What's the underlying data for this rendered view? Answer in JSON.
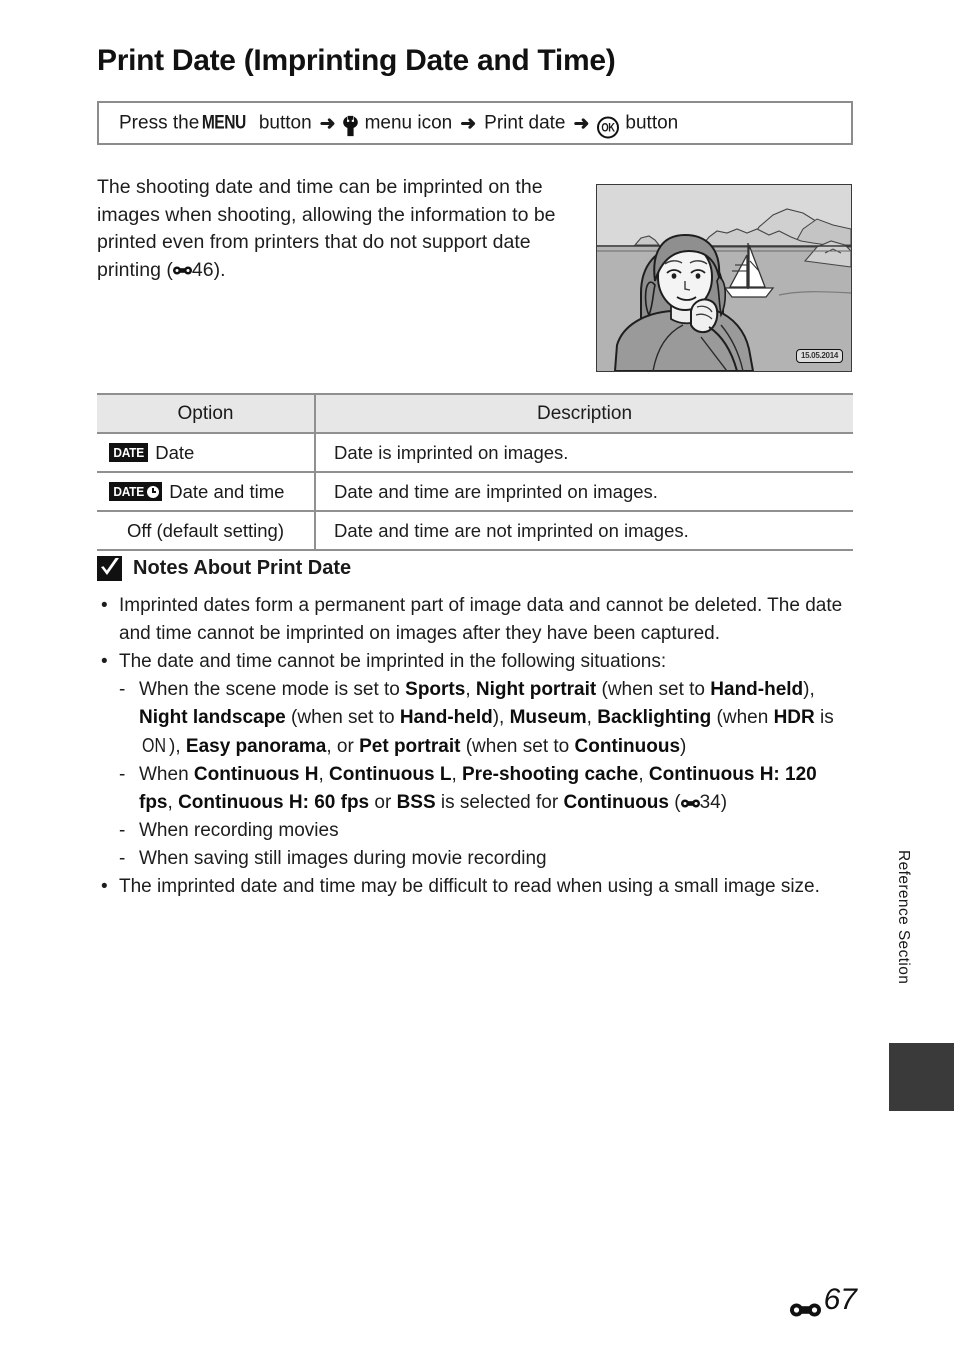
{
  "page": {
    "title": "Print Date (Imprinting Date and Time)",
    "number": "67",
    "number_symbol": "E-reference-icon",
    "section_tab": "Reference Section"
  },
  "menu_path": {
    "press_the": "Press the",
    "menu_glyph": "MENU",
    "button_1": "button",
    "arrow": "➜",
    "setup_icon": "wrench-icon",
    "menu_icon_label": "menu icon",
    "item": "Print date",
    "ok_glyph": "OK",
    "button_2": "button"
  },
  "intro": {
    "part1": "The shooting date and time can be imprinted on the images when shooting, allowing the information to be printed even from printers that do not support date printing (",
    "ref_page": "46",
    "part2": ")."
  },
  "illustration": {
    "alt": "camera-sample-photo",
    "date_stamp": "15.05.2014"
  },
  "table": {
    "headers": [
      "Option",
      "Description"
    ],
    "rows": [
      {
        "badge": "DATE",
        "badge_clock": false,
        "option": "Date",
        "description": "Date is imprinted on images."
      },
      {
        "badge": "DATE",
        "badge_clock": true,
        "option": "Date and time",
        "description": "Date and time are imprinted on images."
      },
      {
        "badge": null,
        "badge_clock": false,
        "option": "Off (default setting)",
        "description": "Date and time are not imprinted on images."
      }
    ]
  },
  "notes": {
    "icon": "check-mark-icon",
    "heading": "Notes About Print Date",
    "bullet_char": "•",
    "dash_char": "-",
    "items": [
      "Imprinted dates form a permanent part of image data and cannot be deleted. The date and time cannot be imprinted on images after they have been captured.",
      "The date and time cannot be imprinted in the following situations:"
    ],
    "sub_items": [
      {
        "id": "scene-modes",
        "segments": [
          {
            "t": "When the scene mode is set to ",
            "b": false
          },
          {
            "t": "Sports",
            "b": true
          },
          {
            "t": ", ",
            "b": false
          },
          {
            "t": "Night portrait",
            "b": true
          },
          {
            "t": " (when set to ",
            "b": false
          },
          {
            "t": "Hand-held",
            "b": true
          },
          {
            "t": "), ",
            "b": false
          },
          {
            "t": "Night landscape",
            "b": true
          },
          {
            "t": " (when set to ",
            "b": false
          },
          {
            "t": "Hand-held",
            "b": true
          },
          {
            "t": "), ",
            "b": false
          },
          {
            "t": "Museum",
            "b": true
          },
          {
            "t": ", ",
            "b": false
          },
          {
            "t": "Backlighting",
            "b": true
          },
          {
            "t": " (when ",
            "b": false
          },
          {
            "t": "HDR",
            "b": true
          },
          {
            "t": " is ",
            "b": false
          },
          {
            "t": "ON",
            "b": false,
            "glyph": "on"
          },
          {
            "t": "), ",
            "b": false
          },
          {
            "t": "Easy panorama",
            "b": true
          },
          {
            "t": ", or ",
            "b": false
          },
          {
            "t": "Pet portrait",
            "b": true
          },
          {
            "t": " (when set to ",
            "b": false
          },
          {
            "t": "Continuous",
            "b": true
          },
          {
            "t": ")",
            "b": false
          }
        ]
      },
      {
        "id": "continuous-modes",
        "segments": [
          {
            "t": "When ",
            "b": false
          },
          {
            "t": "Continuous H",
            "b": true
          },
          {
            "t": ", ",
            "b": false
          },
          {
            "t": "Continuous L",
            "b": true
          },
          {
            "t": ", ",
            "b": false
          },
          {
            "t": "Pre-shooting cache",
            "b": true
          },
          {
            "t": ", ",
            "b": false
          },
          {
            "t": "Continuous H: 120 fps",
            "b": true
          },
          {
            "t": ", ",
            "b": false
          },
          {
            "t": "Continuous H: 60 fps",
            "b": true
          },
          {
            "t": " or ",
            "b": false
          },
          {
            "t": "BSS",
            "b": true
          },
          {
            "t": " is selected for ",
            "b": false
          },
          {
            "t": "Continuous",
            "b": true
          },
          {
            "t": " (",
            "b": false
          },
          {
            "t": "34",
            "b": false,
            "glyph": "ref"
          },
          {
            "t": ")",
            "b": false
          }
        ]
      },
      {
        "id": "recording-movies",
        "segments": [
          {
            "t": "When recording movies",
            "b": false
          }
        ]
      },
      {
        "id": "saving-still-images",
        "segments": [
          {
            "t": "When saving still images during movie recording",
            "b": false
          }
        ]
      }
    ],
    "final_item": "The imprinted date and time may be difficult to read when using a small image size."
  }
}
